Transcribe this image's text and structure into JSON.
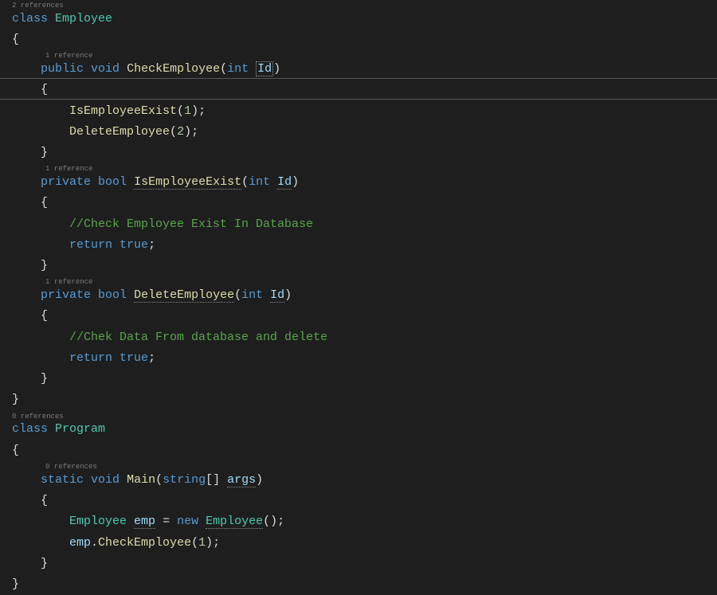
{
  "codelens": {
    "classEmployee": "2 references",
    "checkEmployee": "1 reference",
    "isEmployeeExist": "1 reference",
    "deleteEmployee": "1 reference",
    "classProgram": "0 references",
    "main": "0 references"
  },
  "tokens": {
    "kw_class": "class",
    "kw_public": "public",
    "kw_private": "private",
    "kw_static": "static",
    "kw_void": "void",
    "kw_bool": "bool",
    "kw_int": "int",
    "kw_string": "string",
    "kw_return": "return",
    "kw_true": "true",
    "kw_new": "new",
    "type_Employee": "Employee",
    "type_Program": "Program",
    "m_CheckEmployee": "CheckEmployee",
    "m_IsEmployeeExist": "IsEmployeeExist",
    "m_DeleteEmployee": "DeleteEmployee",
    "m_Main": "Main",
    "p_Id": "Id",
    "p_args": "args",
    "v_emp": "emp",
    "num_1": "1",
    "num_2": "2",
    "comment_isExist": "//Check Employee Exist In Database",
    "comment_delete": "//Chek Data From database and delete"
  }
}
